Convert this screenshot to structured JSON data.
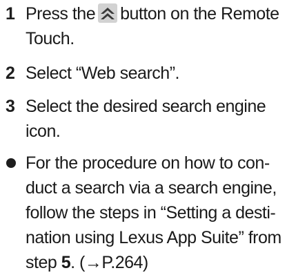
{
  "steps": [
    {
      "number": "1",
      "text_before_icon": "Press the",
      "icon": "double-chevron-up-icon",
      "text_after_icon": "button on the Remote",
      "text_line2": "Touch."
    },
    {
      "number": "2",
      "text": "Select “Web search”."
    },
    {
      "number": "3",
      "text_line1": "Select the desired search engine",
      "text_line2": "icon."
    }
  ],
  "note": {
    "lines": [
      "For the procedure on how to con-",
      "duct a search via a search engine,",
      "follow the steps in “Setting a desti-",
      "nation using Lexus App Suite” from"
    ],
    "last_line_prefix": "step ",
    "step_ref": "5",
    "page_ref": ". (→P.264)"
  },
  "colors": {
    "text": "#1a1a1a",
    "icon_bg": "#d2d2d2",
    "icon_fg": "#3a3a3a"
  }
}
